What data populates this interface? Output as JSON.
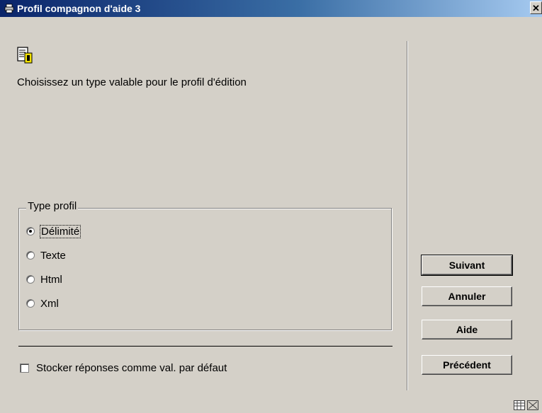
{
  "window": {
    "title": "Profil compagnon d'aide 3",
    "close_glyph": "✕"
  },
  "main": {
    "instruction": "Choisissez un type valable pour le profil d'édition"
  },
  "profile_type": {
    "legend": "Type profil",
    "options": [
      {
        "label": "Délimité",
        "selected": true
      },
      {
        "label": "Texte",
        "selected": false
      },
      {
        "label": "Html",
        "selected": false
      },
      {
        "label": "Xml",
        "selected": false
      }
    ]
  },
  "store_defaults": {
    "label": "Stocker réponses comme val. par défaut",
    "checked": false
  },
  "buttons": {
    "next": "Suivant",
    "cancel": "Annuler",
    "help": "Aide",
    "previous": "Précédent"
  },
  "icons": {
    "title": "printer-icon",
    "doc": "edit-document-icon",
    "status": [
      "grid-icon",
      "resize-icon"
    ]
  }
}
